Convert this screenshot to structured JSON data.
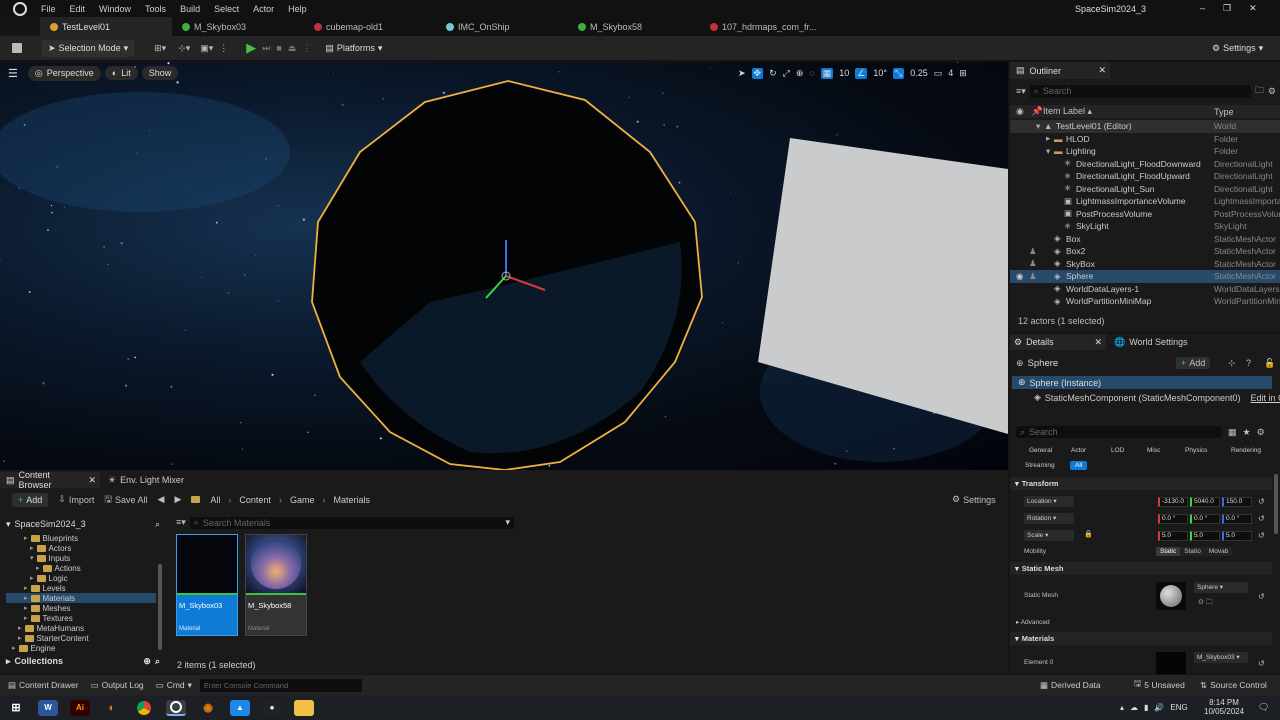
{
  "menu": [
    "File",
    "Edit",
    "Window",
    "Tools",
    "Build",
    "Select",
    "Actor",
    "Help"
  ],
  "project_title": "SpaceSim2024_3",
  "tabs": [
    {
      "label": "TestLevel01",
      "color": "#e0a030"
    },
    {
      "label": "M_Skybox03",
      "color": "#3fae3f"
    },
    {
      "label": "cubemap-old1",
      "color": "#c0303a"
    },
    {
      "label": "IMC_OnShip",
      "color": "#7ac4d8"
    },
    {
      "label": "M_Skybox58",
      "color": "#3fae3f"
    },
    {
      "label": "107_hdrmaps_com_fr...",
      "color": "#c0303a"
    }
  ],
  "toolbar": {
    "selection_mode": "Selection Mode",
    "platforms": "Platforms",
    "settings": "Settings"
  },
  "viewport": {
    "perspective": "Perspective",
    "lit": "Lit",
    "show": "Show",
    "grid_snap": "10",
    "rotation_snap": "10°",
    "scale_snap": "0.25",
    "camera_speed": "4"
  },
  "outliner": {
    "title": "Outliner",
    "search_placeholder": "Search",
    "col_label": "Item Label ▴",
    "col_type": "Type",
    "items": [
      {
        "label": "TestLevel01 (Editor)",
        "type": "World",
        "depth": 3,
        "kind": "world"
      },
      {
        "label": "HLOD",
        "type": "Folder",
        "depth": 4,
        "kind": "folder"
      },
      {
        "label": "Lighting",
        "type": "Folder",
        "depth": 4,
        "kind": "folder"
      },
      {
        "label": "DirectionalLight_FloodDownward",
        "type": "DirectionalLight",
        "depth": 5,
        "kind": "light"
      },
      {
        "label": "DirectionalLight_FloodUpward",
        "type": "DirectionalLight",
        "depth": 5,
        "kind": "light"
      },
      {
        "label": "DirectionalLight_Sun",
        "type": "DirectionalLight",
        "depth": 5,
        "kind": "light"
      },
      {
        "label": "LightmassImportanceVolume",
        "type": "LightmassImportanceVolume",
        "depth": 5,
        "kind": "volume"
      },
      {
        "label": "PostProcessVolume",
        "type": "PostProcessVolume",
        "depth": 5,
        "kind": "volume"
      },
      {
        "label": "SkyLight",
        "type": "SkyLight",
        "depth": 5,
        "kind": "light"
      },
      {
        "label": "Box",
        "type": "StaticMeshActor",
        "depth": 4,
        "kind": "mesh"
      },
      {
        "label": "Box2",
        "type": "StaticMeshActor",
        "depth": 4,
        "kind": "mesh"
      },
      {
        "label": "SkyBox",
        "type": "StaticMeshActor",
        "depth": 4,
        "kind": "mesh"
      },
      {
        "label": "Sphere",
        "type": "StaticMeshActor",
        "depth": 4,
        "kind": "mesh",
        "selected": true
      },
      {
        "label": "WorldDataLayers-1",
        "type": "WorldDataLayers",
        "depth": 4,
        "kind": "mesh"
      },
      {
        "label": "WorldPartitionMiniMap",
        "type": "WorldPartitionMiniMap",
        "depth": 4,
        "kind": "mesh"
      }
    ],
    "footer": "12 actors (1 selected)"
  },
  "details": {
    "tab": "Details",
    "world_settings": "World Settings",
    "actor": "Sphere",
    "add": "Add",
    "instance": "Sphere (Instance)",
    "component": "StaticMeshComponent (StaticMeshComponent0)",
    "edit_in": "Edit in C",
    "search_placeholder": "Search",
    "filters": [
      "General",
      "Actor",
      "LOD",
      "Misc",
      "Physics",
      "Rendering",
      "Streaming",
      "All"
    ],
    "transform": "Transform",
    "location": "Location",
    "rotation": "Rotation",
    "scale": "Scale",
    "loc": [
      "-3130.0",
      "5040.0",
      "150.0"
    ],
    "rot": [
      "0.0 °",
      "0.0 °",
      "0.0 °"
    ],
    "scl": [
      "5.0",
      "5.0",
      "5.0"
    ],
    "mobility": "Mobility",
    "mob_opts": [
      "Static",
      "Statio",
      "Movab"
    ],
    "static_mesh_section": "Static Mesh",
    "static_mesh_label": "Static Mesh",
    "static_mesh_value": "Sphere",
    "advanced": "Advanced",
    "materials": "Materials",
    "element0": "Element 0",
    "element0_value": "M_Skybox03"
  },
  "content_browser": {
    "tab": "Content Browser",
    "tab2": "Env. Light Mixer",
    "add": "Add",
    "import": "Import",
    "save_all": "Save All",
    "path": [
      "All",
      "Content",
      "Game",
      "Materials"
    ],
    "settings": "Settings",
    "root": "SpaceSim2024_3",
    "search_placeholder": "Search Materials",
    "tree": [
      {
        "label": "Blueprints",
        "depth": 3
      },
      {
        "label": "Actors",
        "depth": 4
      },
      {
        "label": "Inputs",
        "depth": 4
      },
      {
        "label": "Actions",
        "depth": 5
      },
      {
        "label": "Logic",
        "depth": 4
      },
      {
        "label": "Levels",
        "depth": 3
      },
      {
        "label": "Materials",
        "depth": 3,
        "selected": true
      },
      {
        "label": "Meshes",
        "depth": 3
      },
      {
        "label": "Textures",
        "depth": 3
      },
      {
        "label": "MetaHumans",
        "depth": 2
      },
      {
        "label": "StarterContent",
        "depth": 2
      },
      {
        "label": "Engine",
        "depth": 1
      }
    ],
    "collections": "Collections",
    "assets": [
      {
        "name": "M_Skybox03",
        "type": "Material",
        "selected": true
      },
      {
        "name": "M_Skybox58",
        "type": "Material",
        "selected": false
      }
    ],
    "count": "2 items (1 selected)"
  },
  "status": {
    "content_drawer": "Content Drawer",
    "output_log": "Output Log",
    "cmd": "Cmd",
    "console_placeholder": "Enter Console Command",
    "derived_data": "Derived Data",
    "unsaved": "5 Unsaved",
    "source_control": "Source Control"
  },
  "taskbar": {
    "lang": "ENG",
    "time": "8:14 PM",
    "date": "10/05/2024"
  },
  "colors": {
    "accent": "#0e7bd6",
    "selection": "#264b6a",
    "play": "#3fc43f",
    "sphere_outline": "#f0b040"
  }
}
